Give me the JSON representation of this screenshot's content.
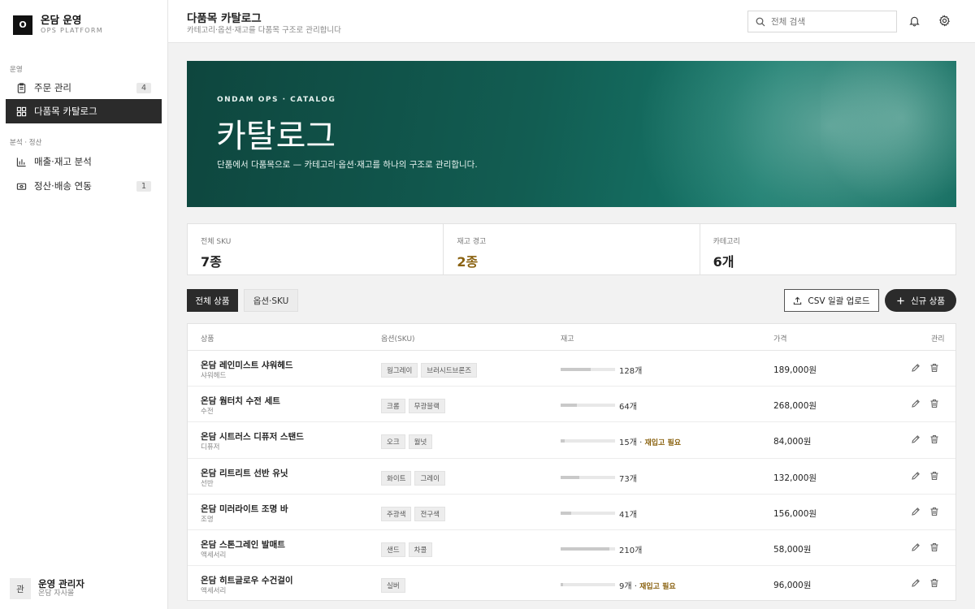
{
  "brand": {
    "logo": "O",
    "name": "온담 운영",
    "sub": "OPS PLATFORM"
  },
  "sidebar": {
    "sections": [
      {
        "label": "운영"
      },
      {
        "label": "분석 · 정산"
      }
    ],
    "items": [
      {
        "label": "주문 관리",
        "badge": "4",
        "icon": "clipboard-icon"
      },
      {
        "label": "다품목 카탈로그",
        "icon": "grid-icon",
        "active": true
      },
      {
        "label": "매출·재고 분석",
        "icon": "bar-chart-icon"
      },
      {
        "label": "정산·배송 연동",
        "badge": "1",
        "icon": "wallet-icon"
      }
    ]
  },
  "user": {
    "avatar": "관",
    "name": "운영 관리자",
    "sub": "온담 자사몰"
  },
  "header": {
    "title": "다품목 카탈로그",
    "subtitle": "카테고리·옵션·재고를 다품목 구조로 관리합니다",
    "search_placeholder": "전체 검색"
  },
  "hero": {
    "kicker": "ONDAM OPS · CATALOG",
    "title": "카탈로그",
    "desc": "단품에서 다품목으로 — 카테고리·옵션·재고를 하나의 구조로 관리합니다."
  },
  "stats": [
    {
      "label": "전체 SKU",
      "value": "7종"
    },
    {
      "label": "재고 경고",
      "value": "2종",
      "warn": true
    },
    {
      "label": "카테고리",
      "value": "6개"
    }
  ],
  "tabs": {
    "all": "전체 상품",
    "sku": "옵션·SKU"
  },
  "buttons": {
    "csv": "CSV 일괄 업로드",
    "new": "신규 상품"
  },
  "table": {
    "headers": {
      "product": "상품",
      "options": "옵션(SKU)",
      "stock": "재고",
      "price": "가격",
      "manage": "관리"
    },
    "rows": [
      {
        "name": "온담 레인미스트 샤워헤드",
        "category": "샤워헤드",
        "options": [
          "웜그레이",
          "브러시드브론즈"
        ],
        "stock": "128개",
        "stock_level": 0.55,
        "restock": "",
        "price": "189,000원"
      },
      {
        "name": "온담 웜터치 수전 세트",
        "category": "수전",
        "options": [
          "크롬",
          "무광블랙"
        ],
        "stock": "64개",
        "stock_level": 0.3,
        "restock": "",
        "price": "268,000원"
      },
      {
        "name": "온담 시트러스 디퓨저 스탠드",
        "category": "디퓨저",
        "options": [
          "오크",
          "월넛"
        ],
        "stock": "15개",
        "stock_level": 0.07,
        "restock": "재입고 필요",
        "price": "84,000원"
      },
      {
        "name": "온담 리트리트 선반 유닛",
        "category": "선반",
        "options": [
          "화이트",
          "그레이"
        ],
        "stock": "73개",
        "stock_level": 0.35,
        "restock": "",
        "price": "132,000원"
      },
      {
        "name": "온담 미러라이트 조명 바",
        "category": "조명",
        "options": [
          "주광색",
          "전구색"
        ],
        "stock": "41개",
        "stock_level": 0.2,
        "restock": "",
        "price": "156,000원"
      },
      {
        "name": "온담 스톤그레인 발매트",
        "category": "액세서리",
        "options": [
          "샌드",
          "차콜"
        ],
        "stock": "210개",
        "stock_level": 0.9,
        "restock": "",
        "price": "58,000원"
      },
      {
        "name": "온담 히트글로우 수건걸이",
        "category": "액세서리",
        "options": [
          "실버"
        ],
        "stock": "9개",
        "stock_level": 0.04,
        "restock": "재입고 필요",
        "price": "96,000원"
      }
    ]
  }
}
